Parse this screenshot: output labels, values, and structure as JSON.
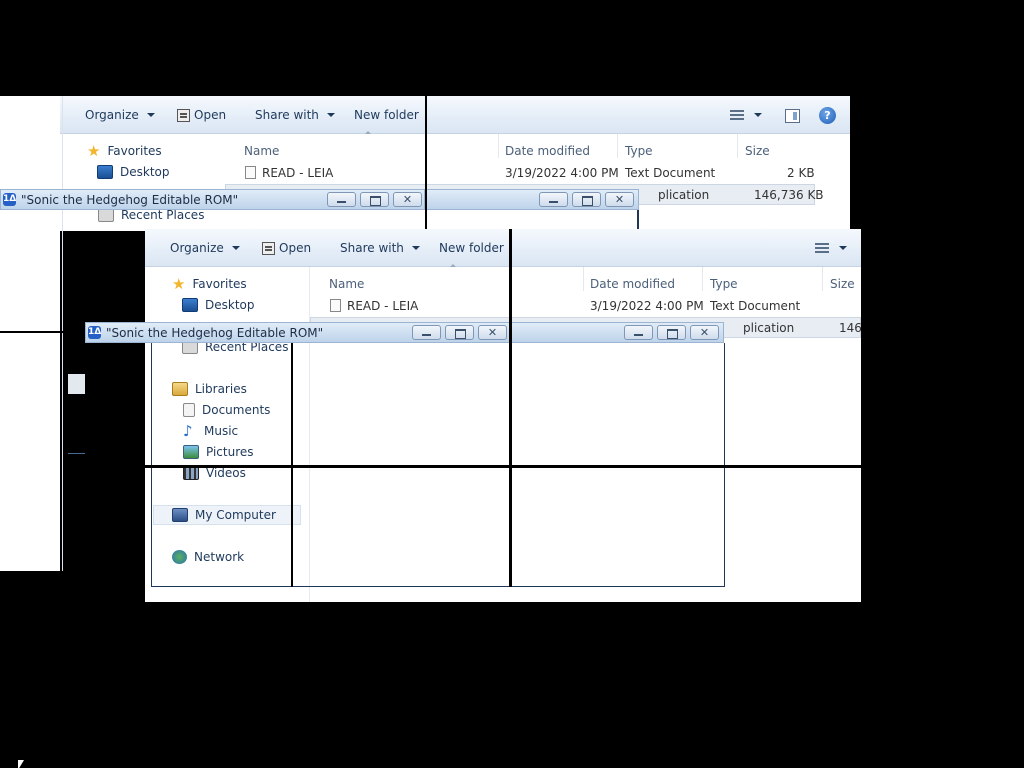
{
  "toolbar": {
    "organize": "Organize",
    "open": "Open",
    "share_with": "Share with",
    "new_folder": "New folder",
    "help": "?"
  },
  "columns": {
    "name": "Name",
    "date_modified": "Date modified",
    "type": "Type",
    "size": "Size"
  },
  "nav": {
    "favorites": "Favorites",
    "desktop": "Desktop",
    "recent_places": "Recent Places",
    "libraries": "Libraries",
    "documents": "Documents",
    "music": "Music",
    "pictures": "Pictures",
    "videos": "Videos",
    "my_computer": "My Computer",
    "network": "Network"
  },
  "files": [
    {
      "name": "READ - LEIA",
      "date": "3/19/2022 4:00 PM",
      "type": "Text Document",
      "size": "2 KB"
    },
    {
      "type_partial": "plication",
      "size": "146,736 KB",
      "size_partial": "146,"
    }
  ],
  "title_window": {
    "title": "\"Sonic the Hedgehog Editable ROM\"",
    "app_icon": "1Δ"
  }
}
